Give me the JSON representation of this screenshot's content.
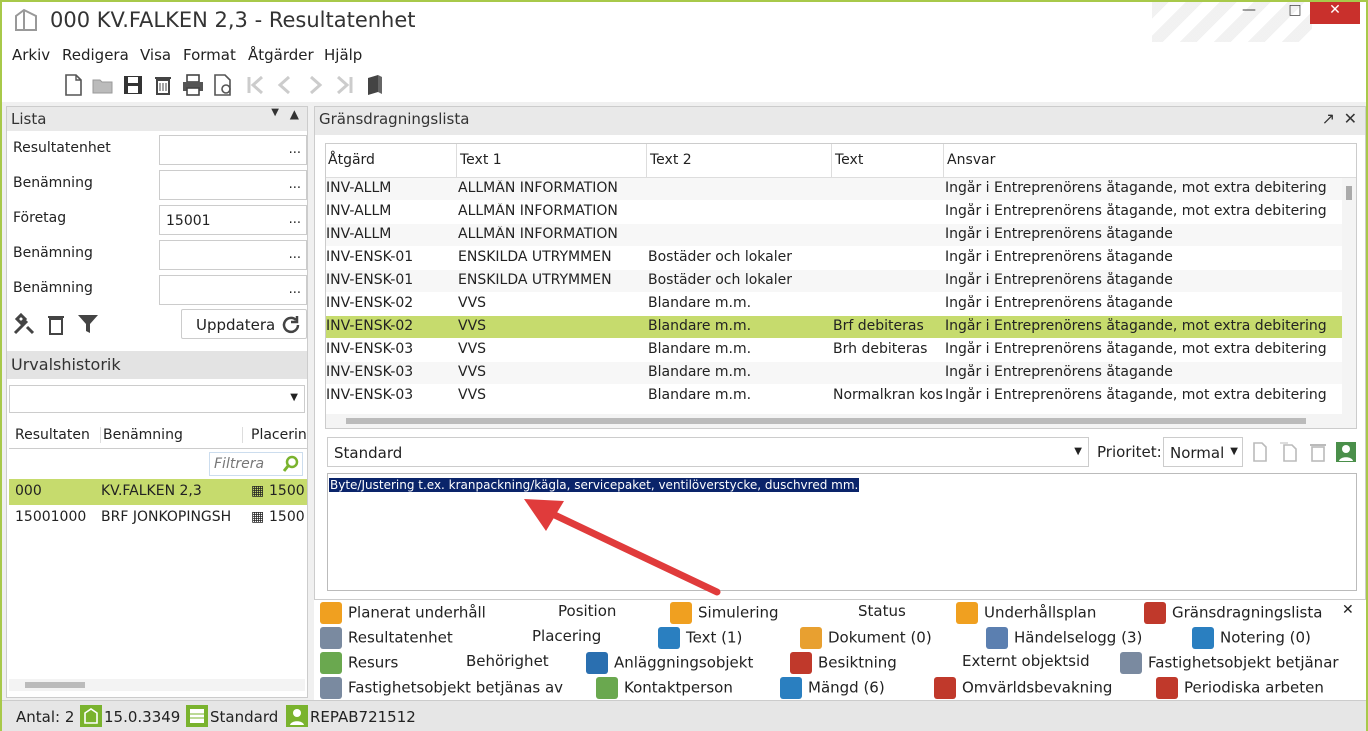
{
  "window": {
    "title": "000 KV.FALKEN 2,3 - Resultatenhet"
  },
  "menu": [
    "Arkiv",
    "Redigera",
    "Visa",
    "Format",
    "Åtgärder",
    "Hjälp"
  ],
  "left_panel": {
    "title": "Lista",
    "fields": [
      {
        "label": "Resultatenhet",
        "value": ""
      },
      {
        "label": "Benämning",
        "value": ""
      },
      {
        "label": "Företag",
        "value": "15001"
      },
      {
        "label": "Benämning",
        "value": ""
      },
      {
        "label": "Benämning",
        "value": ""
      }
    ],
    "dots": "...",
    "update_label": "Uppdatera",
    "history_title": "Urvalshistorik",
    "columns": [
      "Resultaten",
      "Benämning",
      "Placerin"
    ],
    "filter_placeholder": "Filtrera",
    "rows": [
      {
        "id": "000",
        "name": "KV.FALKEN 2,3",
        "place": "1500",
        "selected": true
      },
      {
        "id": "15001000",
        "name": "BRF JÖNKÖPINGSH",
        "place": "1500",
        "selected": false
      }
    ]
  },
  "right_panel": {
    "title": "Gränsdragningslista",
    "columns": [
      "Åtgärd",
      "Text 1",
      "Text 2",
      "Text",
      "Ansvar"
    ],
    "rows": [
      [
        "INV-ALLM",
        "ALLMÄN INFORMATION",
        "",
        "",
        "Ingår i Entreprenörens åtagande, mot extra debitering"
      ],
      [
        "INV-ALLM",
        "ALLMÄN INFORMATION",
        "",
        "",
        "Ingår i Entreprenörens åtagande, mot extra debitering"
      ],
      [
        "INV-ALLM",
        "ALLMÄN INFORMATION",
        "",
        "",
        "Ingår i Entreprenörens åtagande"
      ],
      [
        "INV-ENSK-01",
        "ENSKILDA UTRYMMEN",
        "Bostäder och lokaler",
        "",
        "Ingår i Entreprenörens åtagande"
      ],
      [
        "INV-ENSK-01",
        "ENSKILDA UTRYMMEN",
        "Bostäder och lokaler",
        "",
        "Ingår i Entreprenörens åtagande"
      ],
      [
        "INV-ENSK-02",
        "VVS",
        "Blandare m.m.",
        "",
        "Ingår i Entreprenörens åtagande"
      ],
      [
        "INV-ENSK-02",
        "VVS",
        "Blandare m.m.",
        "Brf debiteras",
        "Ingår i Entreprenörens åtagande, mot extra debitering"
      ],
      [
        "INV-ENSK-03",
        "VVS",
        "Blandare m.m.",
        "Brh debiteras",
        "Ingår i Entreprenörens åtagande, mot extra debitering"
      ],
      [
        "INV-ENSK-03",
        "VVS",
        "Blandare m.m.",
        "",
        "Ingår i Entreprenörens åtagande"
      ],
      [
        "INV-ENSK-03",
        "VVS",
        "Blandare m.m.",
        "Normalkran kos",
        "Ingår i Entreprenörens åtagande, mot extra debitering"
      ]
    ],
    "selected_row": 6,
    "template": "Standard",
    "priority_label": "Prioritet:",
    "priority_value": "Normal",
    "note_text": "Byte/Justering t.ex. kranpackning/kägla, servicepaket, ventilöverstycke, duschvred mm."
  },
  "links": [
    {
      "label": "Planerat underhåll",
      "icon": "gear-orange-icon"
    },
    {
      "label": "Position",
      "icon": ""
    },
    {
      "label": "Simulering",
      "icon": "gear-orange-icon"
    },
    {
      "label": "Status",
      "icon": ""
    },
    {
      "label": "Underhållsplan",
      "icon": "gear-orange-icon"
    },
    {
      "label": "Gränsdragningslista",
      "icon": "doc-red-icon"
    },
    {
      "label": "Resultatenhet",
      "icon": "building-icon"
    },
    {
      "label": "Placering",
      "icon": ""
    },
    {
      "label": "Text (1)",
      "icon": "note-blue-icon"
    },
    {
      "label": "Dokument (0)",
      "icon": "doc-orange-icon"
    },
    {
      "label": "Händelselogg (3)",
      "icon": "log-icon"
    },
    {
      "label": "Notering (0)",
      "icon": "note-blue-icon"
    },
    {
      "label": "Resurs",
      "icon": "person-icon"
    },
    {
      "label": "Behörighet",
      "icon": ""
    },
    {
      "label": "Anläggningsobjekt",
      "icon": "object-blue-icon"
    },
    {
      "label": "Besiktning",
      "icon": "inspect-red-icon"
    },
    {
      "label": "Externt objektsid",
      "icon": ""
    },
    {
      "label": "Fastighetsobjekt betjänar",
      "icon": "building-icon"
    },
    {
      "label": "Fastighetsobjekt betjänas av",
      "icon": "building-icon"
    },
    {
      "label": "Kontaktperson",
      "icon": "person-icon"
    },
    {
      "label": "Mängd (6)",
      "icon": "note-blue-icon"
    },
    {
      "label": "Omvärldsbevakning",
      "icon": "alert-red-icon"
    },
    {
      "label": "Periodiska arbeten",
      "icon": "doc-red-icon"
    }
  ],
  "status": {
    "count": "Antal: 2",
    "version": "15.0.3349",
    "layout": "Standard",
    "user": "REPAB721512"
  },
  "colors": {
    "accent": "#a8c94a",
    "selection": "#c6db6d",
    "arrow": "#e03b3b"
  }
}
